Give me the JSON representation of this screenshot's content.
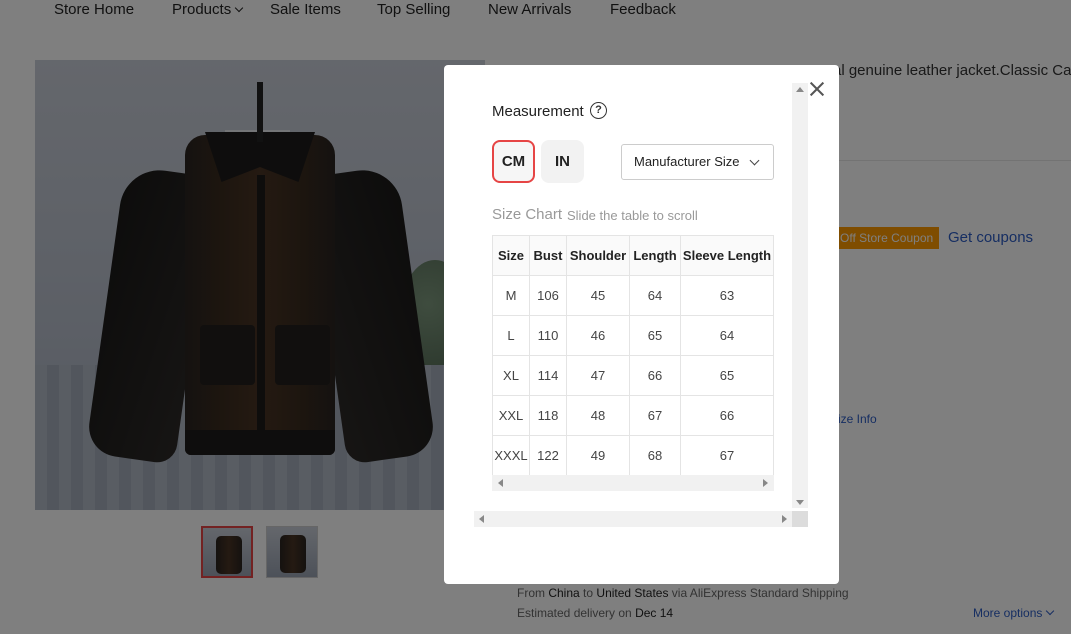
{
  "nav": {
    "items": [
      "Store Home",
      "Products",
      "Sale Items",
      "Top Selling",
      "New Arrivals",
      "Feedback"
    ]
  },
  "background": {
    "title_fragment": "al genuine leather jacket.Classic Ca",
    "coupon_badge": "Off Store Coupon",
    "get_coupons": "Get coupons",
    "size_info": "ize Info",
    "shipping": {
      "from_label": "From",
      "from": "China",
      "to_label": "to",
      "to": "United States",
      "via": "via AliExpress Standard Shipping"
    },
    "delivery": {
      "label": "Estimated delivery on",
      "date": "Dec 14"
    },
    "more_options": "More options"
  },
  "modal": {
    "title": "Measurement",
    "help_glyph": "?",
    "units": [
      "CM",
      "IN"
    ],
    "selected_unit": "CM",
    "size_select": "Manufacturer Size",
    "size_chart_title": "Size Chart",
    "size_chart_hint": "Slide the table to scroll",
    "table": {
      "headers": [
        "Size",
        "Bust",
        "Shoulder",
        "Length",
        "Sleeve Length"
      ],
      "rows": [
        [
          "M",
          "106",
          "45",
          "64",
          "63"
        ],
        [
          "L",
          "110",
          "46",
          "65",
          "64"
        ],
        [
          "XL",
          "114",
          "47",
          "66",
          "65"
        ],
        [
          "XXL",
          "118",
          "48",
          "67",
          "66"
        ],
        [
          "XXXL",
          "122",
          "49",
          "68",
          "67"
        ]
      ]
    }
  },
  "colors": {
    "accent_red": "#e64545",
    "coupon_orange": "#ff9a00",
    "link_blue": "#2c5cc5",
    "overlay": "rgba(0,0,0,0.5)"
  }
}
